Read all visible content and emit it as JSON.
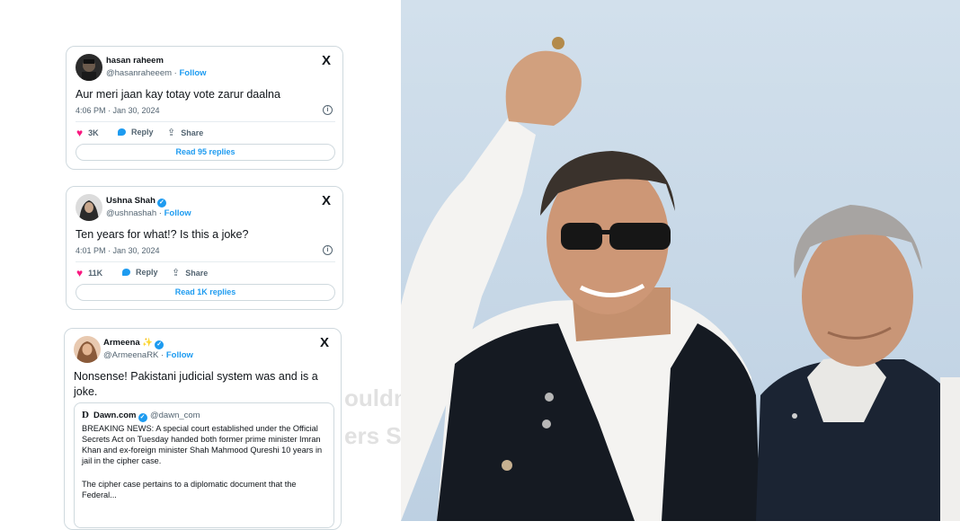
{
  "tweets": [
    {
      "name": "hasan raheem",
      "handle": "@hasanraheeem",
      "separator": "·",
      "follow": "Follow",
      "verified": false,
      "text": "Aur meri jaan kay totay vote zarur daalna",
      "time": "4:06 PM · Jan 30, 2024",
      "likes": "3K",
      "reply_label": "Reply",
      "share_label": "Share",
      "read_replies": "Read 95 replies"
    },
    {
      "name": "Ushna Shah",
      "handle": "@ushnashah",
      "separator": "·",
      "follow": "Follow",
      "verified": true,
      "text": "Ten years for what!? Is this a joke?",
      "time": "4:01 PM · Jan 30, 2024",
      "likes": "11K",
      "reply_label": "Reply",
      "share_label": "Share",
      "read_replies": "Read 1K replies"
    },
    {
      "name": "Armeena",
      "name_emoji": "✨",
      "handle": "@ArmeenaRK",
      "separator": "·",
      "follow": "Follow",
      "verified": true,
      "text": "Nonsense! Pakistani judicial system was and is a joke.",
      "quote": {
        "logo": "D",
        "name": "Dawn.com",
        "handle": "@dawn_com",
        "text1": "BREAKING NEWS: A special court established under the Official Secrets Act on Tuesday handed both former prime minister Imran Khan and ex-foreign minister Shah Mahmood Qureshi 10 years in jail in the cipher case.",
        "text2": "The cipher case pertains to a diplomatic document that the Federal..."
      }
    }
  ],
  "watermark": {
    "line1": "ouldn",
    "line2": "ers S"
  },
  "icons": {
    "x_logo": "X",
    "info": "i",
    "heart": "♥",
    "share": "⇪",
    "verified_check": "✓"
  },
  "colors": {
    "link_blue": "#1d9bf0",
    "heart_pink": "#f91880",
    "muted": "#536471",
    "sky": "#c9d8e6",
    "kurta_white": "#f4f3f1",
    "waistcoat": "#151a22"
  }
}
